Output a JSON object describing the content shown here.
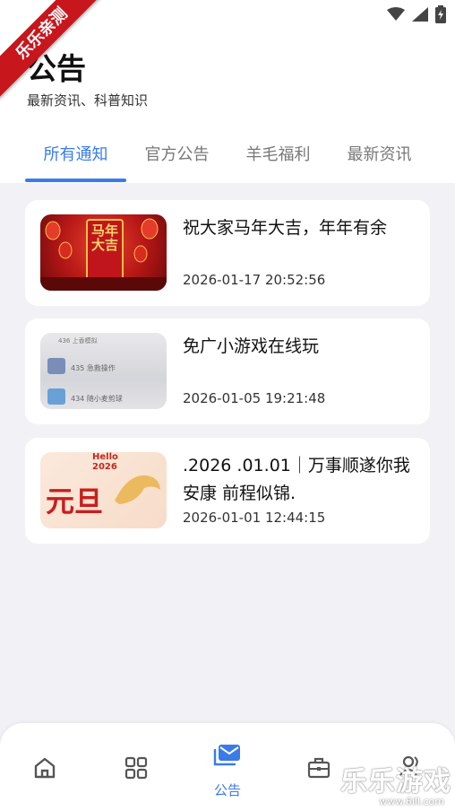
{
  "ribbon": {
    "text": "乐乐亲测"
  },
  "header": {
    "title": "公告",
    "subtitle": "最新资讯、科普知识"
  },
  "tabs": [
    {
      "label": "所有通知",
      "active": true
    },
    {
      "label": "官方公告",
      "active": false
    },
    {
      "label": "羊毛福利",
      "active": false
    },
    {
      "label": "最新资讯",
      "active": false
    }
  ],
  "notices": [
    {
      "title": "祝大家马年大吉，年年有余",
      "time": "2026-01-17 20:52:56",
      "thumb_text": "马年大吉"
    },
    {
      "title": "免广小游戏在线玩",
      "time": "2026-01-05 19:21:48",
      "thumb_text": [
        "436 上香模拟",
        "435 急救操作",
        "434 随小麦剪球"
      ]
    },
    {
      "title": ".2026 .01.01｜万事顺遂你我安康  前程似锦.",
      "time": "2026-01-01 12:44:15",
      "thumb_text": [
        "Hello",
        "2026",
        "元旦"
      ]
    }
  ],
  "bottom_nav": [
    {
      "icon": "home-icon",
      "label": ""
    },
    {
      "icon": "apps-icon",
      "label": ""
    },
    {
      "icon": "mail-icon",
      "label": "公告",
      "active": true
    },
    {
      "icon": "briefcase-icon",
      "label": ""
    },
    {
      "icon": "user-icon",
      "label": ""
    }
  ],
  "watermark": {
    "main": "乐乐游戏",
    "sub": "www.6ill.com"
  },
  "colors": {
    "accent": "#3a7be8",
    "background": "#f2f2f6",
    "ribbon": "#c8161d"
  }
}
